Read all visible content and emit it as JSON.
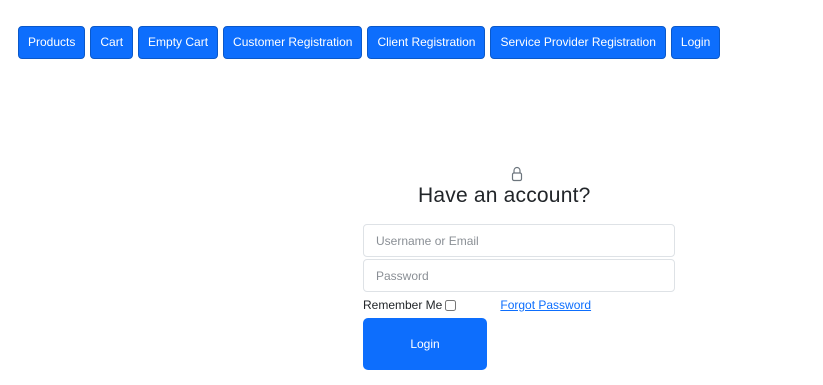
{
  "nav": {
    "items": [
      {
        "label": "Products"
      },
      {
        "label": "Cart"
      },
      {
        "label": "Empty Cart"
      },
      {
        "label": "Customer Registration"
      },
      {
        "label": "Client Registration"
      },
      {
        "label": "Service Provider Registration"
      },
      {
        "label": "Login"
      }
    ]
  },
  "login": {
    "icon": "lock-icon",
    "title": "Have an account?",
    "username_placeholder": "Username or Email",
    "password_placeholder": "Password",
    "remember_label": "Remember Me",
    "forgot_label": "Forgot Password",
    "submit_label": "Login"
  },
  "colors": {
    "accent": "#0d6efd",
    "link": "#0d6efd",
    "text": "#212529"
  }
}
